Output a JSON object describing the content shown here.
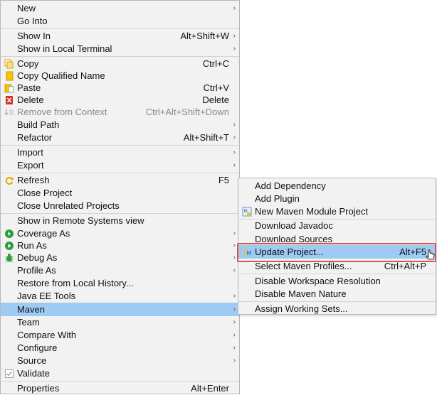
{
  "main_menu": {
    "items": [
      {
        "label": "New",
        "accel": "",
        "arrow": true
      },
      {
        "label": "Go Into",
        "accel": "",
        "arrow": false
      },
      {
        "label": "Show In",
        "accel": "Alt+Shift+W",
        "arrow": true
      },
      {
        "label": "Show in Local Terminal",
        "accel": "",
        "arrow": true
      },
      {
        "label": "Copy",
        "accel": "Ctrl+C",
        "arrow": false,
        "icon": "copy-icon"
      },
      {
        "label": "Copy Qualified Name",
        "accel": "",
        "arrow": false,
        "icon": "copy-qualified-name-icon"
      },
      {
        "label": "Paste",
        "accel": "Ctrl+V",
        "arrow": false,
        "icon": "paste-icon"
      },
      {
        "label": "Delete",
        "accel": "Delete",
        "arrow": false,
        "icon": "delete-icon"
      },
      {
        "label": "Remove from Context",
        "accel": "Ctrl+Alt+Shift+Down",
        "arrow": false,
        "icon": "remove-from-context-icon",
        "disabled": true
      },
      {
        "label": "Build Path",
        "accel": "",
        "arrow": true
      },
      {
        "label": "Refactor",
        "accel": "Alt+Shift+T",
        "arrow": true
      },
      {
        "label": "Import",
        "accel": "",
        "arrow": true
      },
      {
        "label": "Export",
        "accel": "",
        "arrow": true
      },
      {
        "label": "Refresh",
        "accel": "F5",
        "arrow": false,
        "icon": "refresh-icon"
      },
      {
        "label": "Close Project",
        "accel": "",
        "arrow": false
      },
      {
        "label": "Close Unrelated Projects",
        "accel": "",
        "arrow": false
      },
      {
        "label": "Show in Remote Systems view",
        "accel": "",
        "arrow": false
      },
      {
        "label": "Coverage As",
        "accel": "",
        "arrow": true,
        "icon": "coverage-icon"
      },
      {
        "label": "Run As",
        "accel": "",
        "arrow": true,
        "icon": "run-icon"
      },
      {
        "label": "Debug As",
        "accel": "",
        "arrow": true,
        "icon": "debug-bug-icon"
      },
      {
        "label": "Profile As",
        "accel": "",
        "arrow": true
      },
      {
        "label": "Restore from Local History...",
        "accel": "",
        "arrow": false
      },
      {
        "label": "Java EE Tools",
        "accel": "",
        "arrow": true
      },
      {
        "label": "Maven",
        "accel": "",
        "arrow": true,
        "highlighted": true
      },
      {
        "label": "Team",
        "accel": "",
        "arrow": true
      },
      {
        "label": "Compare With",
        "accel": "",
        "arrow": true
      },
      {
        "label": "Configure",
        "accel": "",
        "arrow": true
      },
      {
        "label": "Source",
        "accel": "",
        "arrow": true
      },
      {
        "label": "Validate",
        "accel": "",
        "arrow": false,
        "icon": "validate-checkbox-icon"
      },
      {
        "label": "Properties",
        "accel": "Alt+Enter",
        "arrow": false
      }
    ]
  },
  "maven_submenu": {
    "items": [
      {
        "label": "Add Dependency",
        "accel": ""
      },
      {
        "label": "Add Plugin",
        "accel": ""
      },
      {
        "label": "New Maven Module Project",
        "accel": "",
        "icon": "maven-module-icon"
      },
      {
        "label": "Download Javadoc",
        "accel": ""
      },
      {
        "label": "Download Sources",
        "accel": ""
      },
      {
        "label": "Update Project...",
        "accel": "Alt+F5",
        "icon": "maven-update-icon",
        "highlighted": true
      },
      {
        "label": "Select Maven Profiles...",
        "accel": "Ctrl+Alt+P"
      },
      {
        "label": "Disable Workspace Resolution",
        "accel": ""
      },
      {
        "label": "Disable Maven Nature",
        "accel": ""
      },
      {
        "label": "Assign Working Sets...",
        "accel": ""
      }
    ]
  },
  "icons": {
    "arrow": "submenu-arrow-icon",
    "cursor": "mouse-cursor-icon"
  },
  "colors": {
    "menu_bg": "#f2f2f2",
    "highlight": "#9dcbf3",
    "focus_outline": "#d9534f",
    "disabled_text": "#8a8a8a"
  }
}
